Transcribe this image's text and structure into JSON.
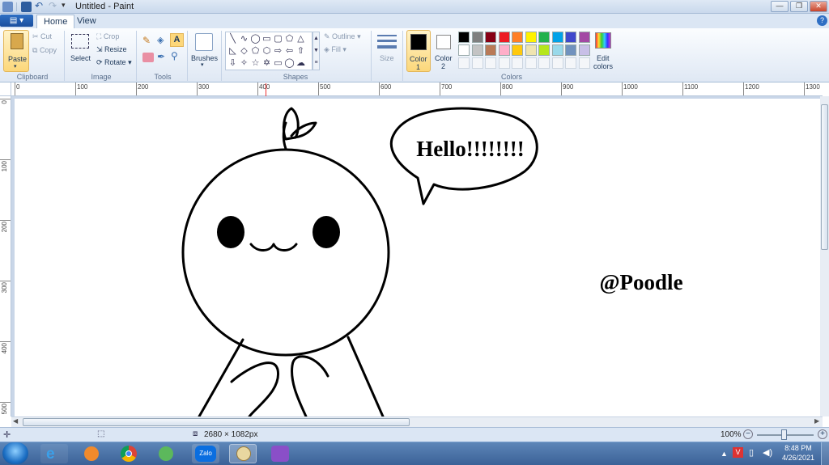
{
  "window": {
    "title": "Untitled - Paint",
    "controls": {
      "minimize": "—",
      "maximize": "❐",
      "close": "✕",
      "help": "?"
    }
  },
  "ribbon_tabs": [
    {
      "label": "Home",
      "active": true
    },
    {
      "label": "View",
      "active": false
    }
  ],
  "clipboard": {
    "paste": "Paste",
    "cut": "Cut",
    "copy": "Copy",
    "group": "Clipboard"
  },
  "image": {
    "select": "Select",
    "crop": "Crop",
    "resize": "Resize",
    "rotate": "Rotate",
    "group": "Image"
  },
  "tools": {
    "group": "Tools"
  },
  "brushes": {
    "label": "Brushes"
  },
  "shapes": {
    "group": "Shapes",
    "outline": "Outline",
    "fill": "Fill"
  },
  "size": {
    "label": "Size"
  },
  "colors": {
    "color1": "Color",
    "color1_num": "1",
    "color2": "Color",
    "color2_num": "2",
    "edit": "Edit",
    "edit2": "colors",
    "group": "Colors",
    "color1_value": "#000000",
    "color2_value": "#ffffff",
    "palette_row1": [
      "#000000",
      "#7f7f7f",
      "#880015",
      "#ed1c24",
      "#ff7f27",
      "#fff200",
      "#22b14c",
      "#00a2e8",
      "#3f48cc",
      "#a349a4"
    ],
    "palette_row2": [
      "#ffffff",
      "#c3c3c3",
      "#b97a57",
      "#ffaec9",
      "#ffc90e",
      "#efe4b0",
      "#b5e61d",
      "#99d9ea",
      "#7092be",
      "#c8bfe7"
    ]
  },
  "ruler_top": [
    "0",
    "100",
    "200",
    "300",
    "400",
    "500",
    "600",
    "700",
    "800",
    "900",
    "1000",
    "1100",
    "1200",
    "1300"
  ],
  "ruler_left": [
    "0",
    "100",
    "200",
    "300",
    "400",
    "500"
  ],
  "drawing": {
    "speech_text": "Hello!!!!!!!!",
    "signature": "@Poodle"
  },
  "status": {
    "dimensions": "2680 × 1082px",
    "zoom": "100%"
  },
  "taskbar": {
    "time": "8:48 PM",
    "date": "4/26/2021",
    "zalo": "Zalo"
  }
}
